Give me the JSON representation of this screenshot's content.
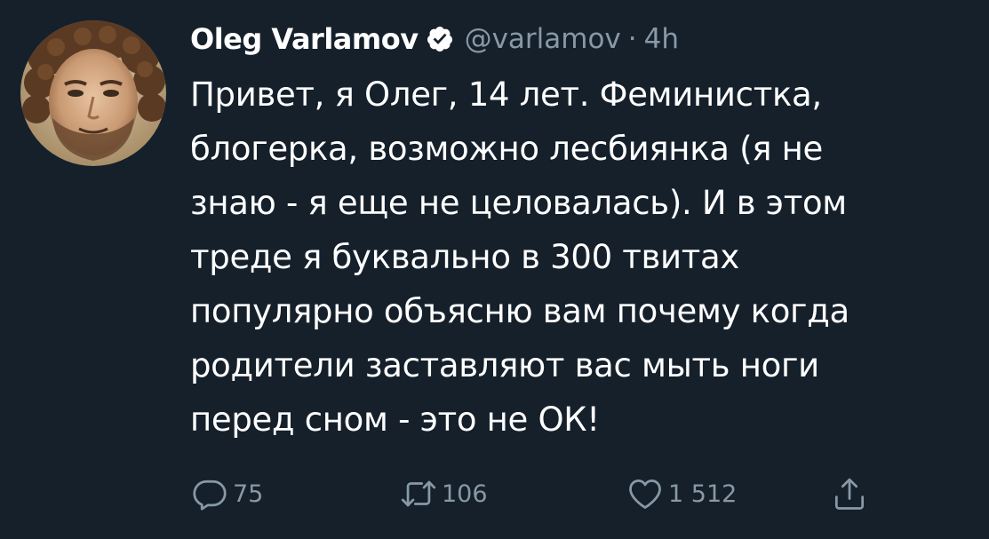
{
  "author": {
    "name": "Oleg Varlamov",
    "handle": "@varlamov",
    "separator": "·",
    "time": "4h",
    "verified": true,
    "avatar_icon": "profile-photo"
  },
  "tweet": {
    "text": "Привет, я Олег, 14 лет. Феминистка,\nблогерка, возможно лесбиянка (я не\nзнаю - я еще не целовалась). И в этом\nтреде я буквально в 300 твитах\nпопулярно объясню вам почему когда\nродители заставляют вас мыть ноги\nперед сном - это не ОК!"
  },
  "actions": {
    "reply_count": "75",
    "retweet_count": "106",
    "like_count": "1 512",
    "share_label": ""
  },
  "colors": {
    "background": "#15202b",
    "text": "#ffffff",
    "muted": "#8899a6"
  }
}
